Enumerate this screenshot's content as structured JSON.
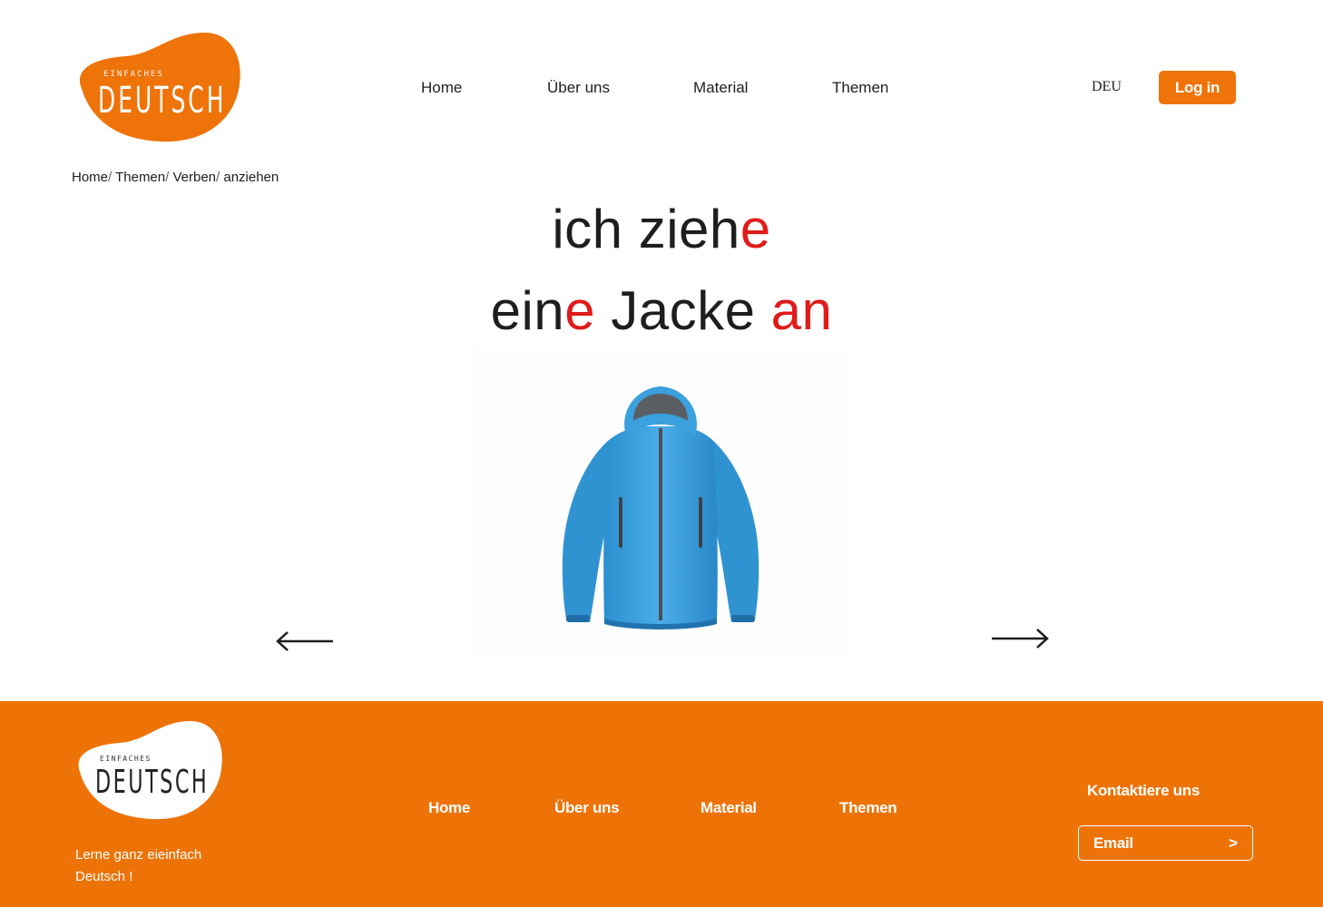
{
  "header": {
    "logo": {
      "small": "EINFACHES",
      "big": "DEUTSCH"
    },
    "nav": [
      "Home",
      "Über uns",
      "Material",
      "Themen"
    ],
    "language": "DEU",
    "login_label": "Log in"
  },
  "breadcrumb": [
    "Home",
    "Themen",
    "Verben",
    "anziehen"
  ],
  "lesson": {
    "line1": {
      "black": "ich zieh",
      "red": "e"
    },
    "line2": {
      "part1": "ein",
      "part2": "e",
      "part3": " Jacke ",
      "part4": "an"
    },
    "image_icon": "blue-jacket-image",
    "colors": {
      "highlight": "#e01b1b",
      "text": "#1e1e1e"
    }
  },
  "navigation": {
    "prev_icon": "arrow-left-icon",
    "next_icon": "arrow-right-icon"
  },
  "footer": {
    "logo": {
      "small": "EINFACHES",
      "big": "DEUTSCH"
    },
    "tagline": "Lerne ganz eieinfach Deutsch !",
    "nav": [
      "Home",
      "Über uns",
      "Material",
      "Themen"
    ],
    "contact_title": "Kontaktiere uns",
    "email_placeholder": "Email",
    "email_submit": ">"
  },
  "colors": {
    "brand": "#ee7309",
    "footer_bg": "#ed7307"
  }
}
